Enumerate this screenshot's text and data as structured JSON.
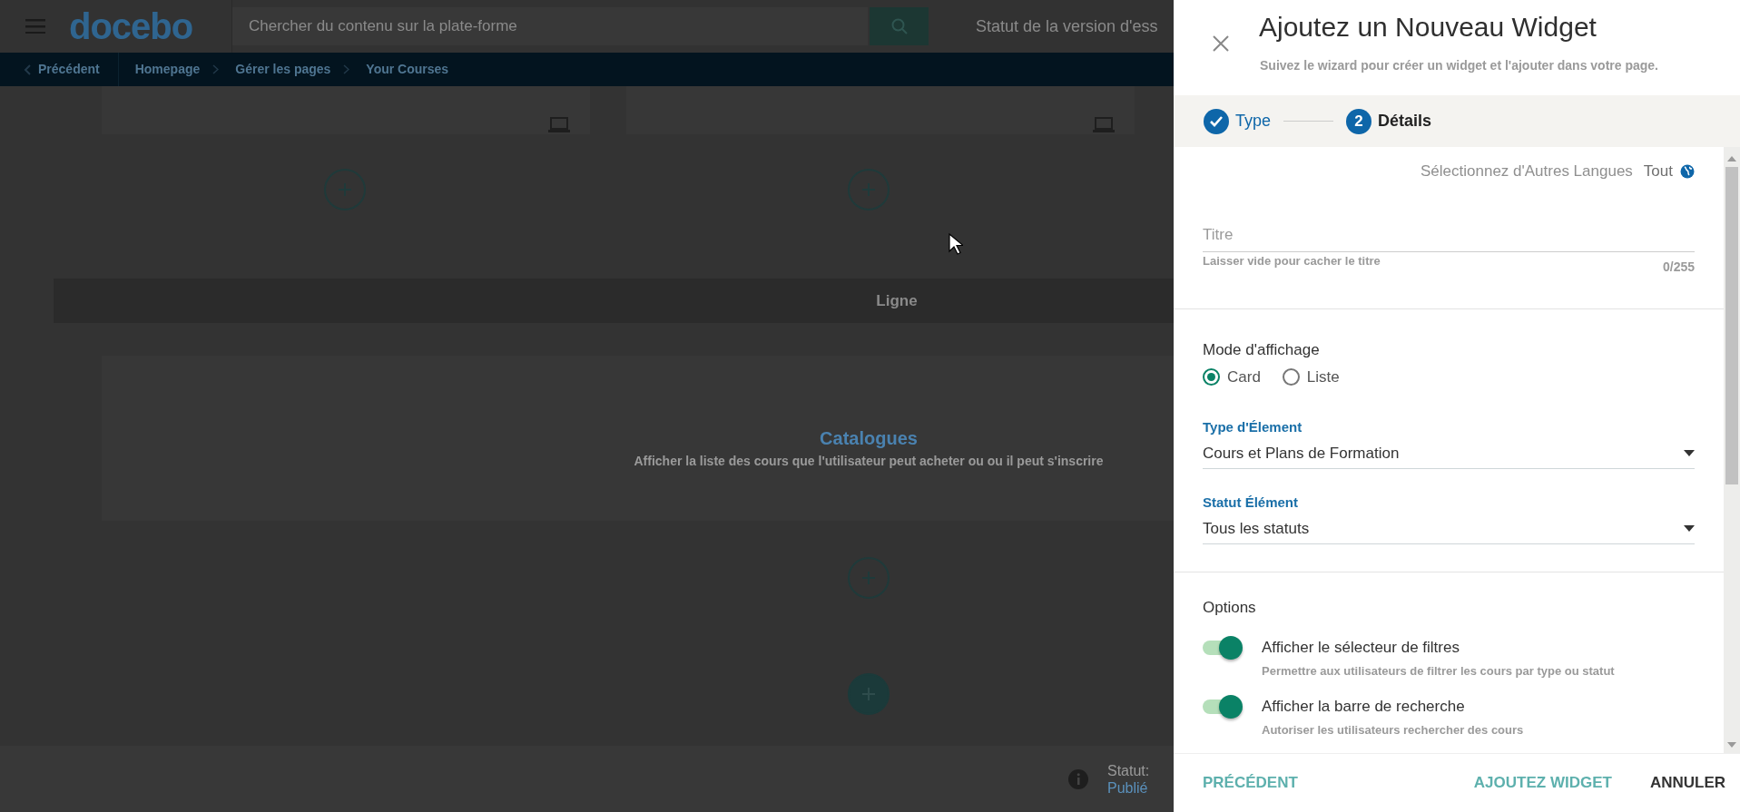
{
  "header": {
    "logo": "docebo",
    "search_placeholder": "Chercher du contenu sur la plate-forme",
    "version_status": "Statut de la version d'ess"
  },
  "breadcrumb": {
    "back": "Précédent",
    "items": [
      "Homepage",
      "Gérer les pages",
      "Your Courses"
    ]
  },
  "canvas": {
    "row_label": "Ligne",
    "widget": {
      "title": "Catalogues",
      "description": "Afficher la liste des cours que l'utilisateur peut acheter ou ou il peut s'inscrire"
    }
  },
  "page_status": {
    "label": "Statut:",
    "value": "Publié"
  },
  "panel": {
    "title": "Ajoutez un Nouveau Widget",
    "subtitle": "Suivez le wizard pour créer un widget et l'ajouter dans votre page.",
    "steps": [
      {
        "label": "Type",
        "done": true,
        "selected": false
      },
      {
        "number": "2",
        "label": "Détails",
        "done": false,
        "selected": true
      }
    ],
    "languages": {
      "label": "Sélectionnez d'Autres Langues",
      "value": "Tout"
    },
    "title_field": {
      "placeholder": "Titre",
      "hint": "Laisser vide pour cacher le titre",
      "counter": "0/255"
    },
    "display_mode": {
      "label": "Mode d'affichage",
      "options": [
        {
          "label": "Card",
          "selected": true
        },
        {
          "label": "Liste",
          "selected": false
        }
      ]
    },
    "selects": [
      {
        "label": "Type d'Élement",
        "value": "Cours et Plans de Formation"
      },
      {
        "label": "Statut Élément",
        "value": "Tous les statuts"
      }
    ],
    "options": {
      "title": "Options",
      "toggles": [
        {
          "label": "Afficher le sélecteur de filtres",
          "description": "Permettre aux utilisateurs de filtrer les cours par type ou statut",
          "on": true
        },
        {
          "label": "Afficher la barre de recherche",
          "description": "Autoriser les utilisateurs rechercher des cours",
          "on": true
        }
      ]
    },
    "footer": {
      "back": "PRÉCÉDENT",
      "add": "AJOUTEZ WIDGET",
      "cancel": "ANNULER"
    }
  }
}
